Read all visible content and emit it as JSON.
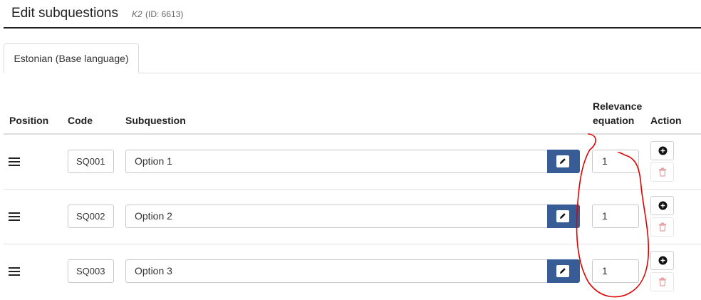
{
  "header": {
    "title": "Edit subquestions",
    "question_code": "K2",
    "question_id": "(ID: 6613)"
  },
  "tabs": [
    {
      "label": "Estonian (Base language)",
      "active": true
    }
  ],
  "table": {
    "columns": {
      "position": "Position",
      "code": "Code",
      "subquestion": "Subquestion",
      "relevance_line1": "Relevance",
      "relevance_line2": "equation",
      "action": "Action"
    },
    "rows": [
      {
        "code": "SQ001",
        "subquestion": "Option 1",
        "relevance": "1"
      },
      {
        "code": "SQ002",
        "subquestion": "Option 2",
        "relevance": "1"
      },
      {
        "code": "SQ003",
        "subquestion": "Option 3",
        "relevance": "1"
      }
    ]
  },
  "icons": {
    "drag": "drag-handle-icon",
    "edit": "pencil-icon",
    "add": "plus-circle-icon",
    "delete": "trash-icon"
  },
  "colors": {
    "edit_button": "#385c95",
    "annotation": "#e00000",
    "delete_icon": "#e8a0a0"
  }
}
